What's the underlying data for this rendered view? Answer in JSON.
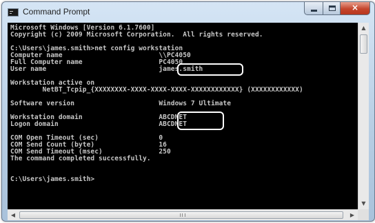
{
  "window": {
    "title": "Command Prompt",
    "close_glyph": "×"
  },
  "console": {
    "lines": [
      "Microsoft Windows [Version 6.1.7600]",
      "Copyright (c) 2009 Microsoft Corporation.  All rights reserved.",
      "",
      "C:\\Users\\james.smith>net config workstation",
      "Computer name                        \\\\PC4050",
      "Full Computer name                   PC4050",
      "User name                            james.smith",
      "",
      "Workstation active on",
      "        NetBT_Tcpip_{XXXXXXXX-XXXX-XXXX-XXXX-XXXXXXXXXXXX} (XXXXXXXXXXXX)",
      "",
      "Software version                     Windows 7 Ultimate",
      "",
      "Workstation domain                   ABCDNET",
      "Logon domain                         ABCDNET",
      "",
      "COM Open Timeout (sec)               0",
      "COM Send Count (byte)                16",
      "COM Send Timeout (msec)              250",
      "The command completed successfully.",
      "",
      "",
      "C:\\Users\\james.smith>"
    ]
  },
  "scrollbars": {
    "up_arrow": "▲",
    "down_arrow": "▼",
    "left_arrow": "◀",
    "right_arrow": "▶"
  },
  "colors": {
    "console_background": "#000000",
    "console_text": "#c8c8c8",
    "highlight_border": "#ffffff"
  }
}
